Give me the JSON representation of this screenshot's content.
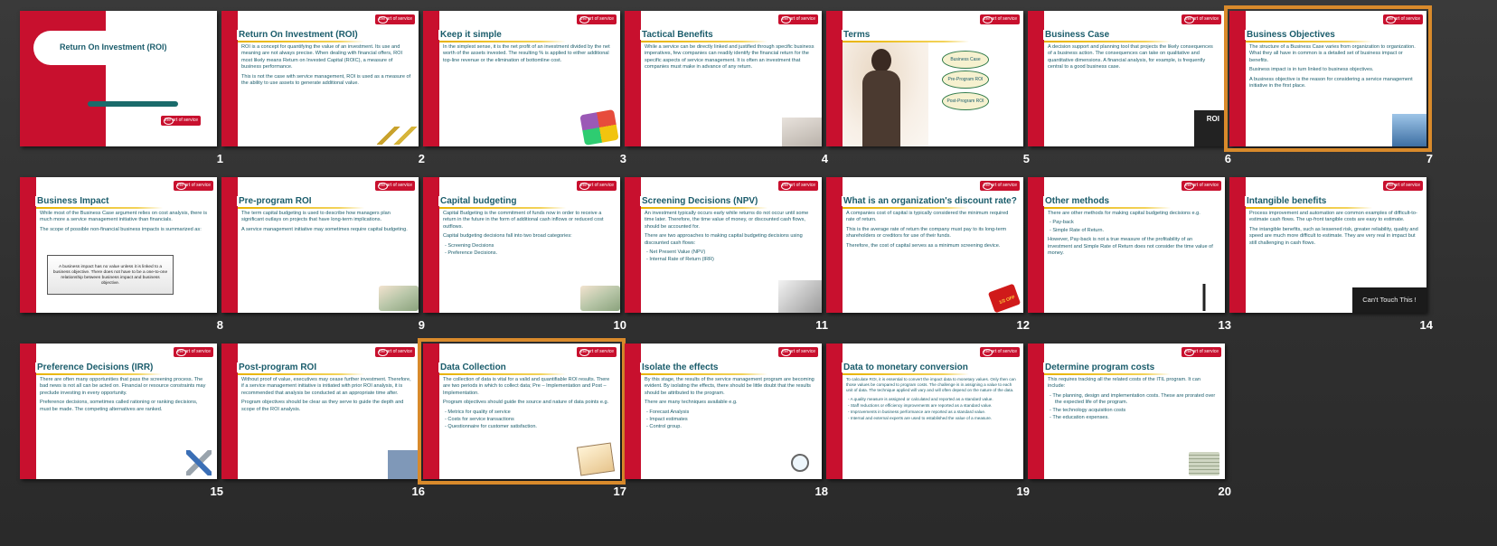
{
  "slides": [
    {
      "number": "1",
      "title": "Return On Investment (ROI)",
      "body": []
    },
    {
      "number": "2",
      "title": "Return On Investment (ROI)",
      "body": [
        "ROI is a concept for quantifying the value of an investment.  Its use and meaning are not always precise.  When dealing with financial offers, ROI most likely means Return on Invested Capital (ROIC), a measure of business performance.",
        "This is not the case with service management, ROI is used as a measure of the ability to use assets to generate additional value."
      ]
    },
    {
      "number": "3",
      "title": "Keep it simple",
      "body": [
        "In the simplest sense, it is the net profit of an investment divided by the net worth of the assets invested.  The resulting % is applied to either additional top-line revenue or the elimination of bottomline cost."
      ]
    },
    {
      "number": "4",
      "title": "Tactical Benefits",
      "body": [
        "While a service can be directly linked and justified through specific business imperatives, few companies can readily identify the financial return for the specific aspects of service management.  It is often an investment that companies must make in advance of any return."
      ]
    },
    {
      "number": "5",
      "title": "Terms",
      "body": [],
      "bubbles": [
        "Business Case",
        "Pre-Program ROI",
        "Post-Program ROI"
      ]
    },
    {
      "number": "6",
      "title": "Business Case",
      "body": [
        "A decision support and planning tool that projects the likely consequences of a business action.  The consequences can take on qualitative and quantitative dimensions.  A financial analysis, for example, is frequently central to a good business case."
      ]
    },
    {
      "number": "7",
      "title": "Business Objectives",
      "body": [
        "The structure of a Business Case varies from organization to organization.  What they all have in common is a detailed set of business impact or benefits.",
        "Business impact is in turn linked to business objectives.",
        "A business objective is the reason for considering a service management initiative in the first place."
      ]
    },
    {
      "number": "8",
      "title": "Business Impact",
      "body": [
        "While most of the Business Case argument relies on cost analysis, there is much more a service management initiative than financials.",
        "The scope of possible non-financial business impacts is summarized as:"
      ],
      "box": "A business impact has no value unless it is linked to a business objective. There does not have to be a one-to-one relationship between business impact and business objective."
    },
    {
      "number": "9",
      "title": "Pre-program ROI",
      "body": [
        "The term capital budgeting is used to describe how managers plan significant outlays on projects that have long-term implications.",
        "A service management initiative may sometimes require capital budgeting."
      ]
    },
    {
      "number": "10",
      "title": "Capital budgeting",
      "body": [
        "Capital Budgeting is the commitment of funds now in order to receive a return in the future in the form of additional cash inflows or reduced cost outflows.",
        "Capital budgeting decisions fall into two broad categories:"
      ],
      "list": [
        "Screening Decisions",
        "Preference Decisions."
      ]
    },
    {
      "number": "11",
      "title": "Screening Decisions (NPV)",
      "body": [
        "An investment typically occurs early while returns do not occur until some time later.  Therefore, the time value of money, or discounted cash flows, should be accounted for.",
        "There are two approaches to making capital budgeting decisions using discounted cash flows:"
      ],
      "list": [
        "Net Present Value (NPV)",
        "Internal Rate of Return (IRR)"
      ]
    },
    {
      "number": "12",
      "title": "What is an organization's discount rate?",
      "body": [
        "A companies cost of capital is typically considered the minimum required rate of return.",
        "This is the average rate of return the company must pay to its long-term shareholders or creditors for use of their funds.",
        "Therefore, the cost of capital serves as a minimum screening device."
      ]
    },
    {
      "number": "13",
      "title": "Other methods",
      "body": [
        "There are other methods for making capital budgeting decisions e.g."
      ],
      "list": [
        "Pay-back",
        "Simple Rate of Return."
      ],
      "after": [
        "However, Pay-back is not a true measure of the profitability of an investment and Simple Rate of Return does not consider the time value of money."
      ]
    },
    {
      "number": "14",
      "title": "Intangible benefits",
      "body": [
        "Process improvement and automation are common examples of difficult-to-estimate cash flows.  The up-front tangible costs are easy to estimate.",
        "The intangible benefits, such as lessened risk, greater reliability, quality and speed are much more difficult to estimate.  They are very real in impact but still challenging in cash flows."
      ],
      "banner": "Can't Touch This !"
    },
    {
      "number": "15",
      "title": "Preference Decisions (IRR)",
      "body": [
        "There are often many opportunities that pass the screening process.  The bad news is not all can be acted on.  Financial or resource constraints may preclude investing in every opportunity.",
        "Preference decisions, sometimes called rationing or ranking decisions, must be made.  The competing alternatives are ranked."
      ]
    },
    {
      "number": "16",
      "title": "Post-program ROI",
      "body": [
        "Without proof of value, executives may cease further investment.  Therefore, if a service management initiative is initiated with prior ROI analysis, it is recommended that analysis be conducted at an appropriate time after.",
        "Program objectives should be clear as they serve to guide the depth and scope of the ROI analysis."
      ]
    },
    {
      "number": "17",
      "title": "Data Collection",
      "body": [
        "The collection of data is vital for a valid and quantifiable ROI results.  There are two periods in which to collect data; Pre – Implementation and Post – Implementation.",
        "Program objectives should guide the source and nature of data points e.g."
      ],
      "list": [
        "Metrics for quality of service",
        "Costs for service transactions",
        "Questionnaire for customer satisfaction."
      ]
    },
    {
      "number": "18",
      "title": "Isolate the effects",
      "body": [
        "By this stage, the results of the service management program are becoming evident.  By isolating the effects, there should be little doubt that the results should be attributed to the program.",
        "There are many techniques available e.g."
      ],
      "list": [
        "Forecast Analysis",
        "Impact estimates",
        "Control group."
      ]
    },
    {
      "number": "19",
      "title": "Data to monetary conversion",
      "body": [
        "To calculate ROI, it is essential to convert the impact data to monetary values.  Only then can those values be compared to program costs. The challenge is in assigning a value to each unit of data.  The technique applied will vary and will often depend on the nature of the data."
      ],
      "list": [
        "A quality measure is assigned or calculated and reported as a standard value.",
        "Staff reductions or efficiency improvements are reported as a standard value.",
        "Improvements in business performance are reported as a standard value.",
        "Internal and external experts are used to established the value of a measure."
      ]
    },
    {
      "number": "20",
      "title": "Determine program costs",
      "body": [
        "This requires tracking all the related costs of the ITIL program.  It can include:"
      ],
      "list": [
        "The planning, design and implementation costs. These are prorated over the expected life of the program.",
        "The technology acquisition costs",
        "The education expenses."
      ]
    }
  ],
  "logo_text": "the art of service",
  "roi_badge": "ROI",
  "half_off": "1/2 OFF",
  "colors": {
    "accent": "#c8102e",
    "title": "#1a5c6b",
    "highlight": "#e8b200",
    "selection": "#d98a2b"
  }
}
